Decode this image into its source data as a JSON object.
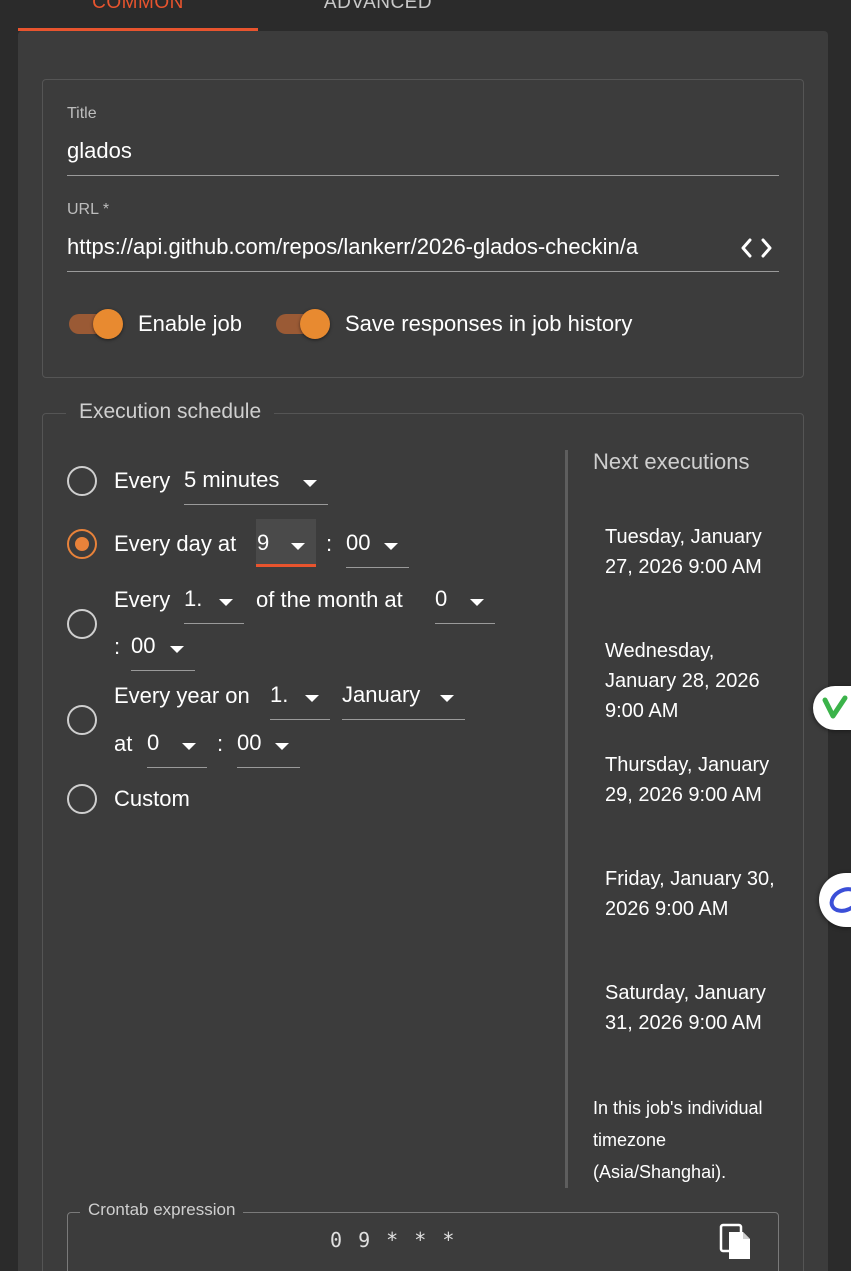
{
  "tabs": [
    {
      "label": "COMMON",
      "active": true
    },
    {
      "label": "ADVANCED",
      "active": false
    }
  ],
  "colors": {
    "accent": "#e8542e",
    "toggle_on": "#e88a30",
    "background": "#3c3c3c"
  },
  "form": {
    "title_label": "Title",
    "title_value": "glados",
    "url_label": "URL *",
    "url_value": "https://api.github.com/repos/lankerr/2026-glados-checkin/a",
    "url_icon": "code-icon",
    "toggles": [
      {
        "label": "Enable job",
        "on": true
      },
      {
        "label": "Save responses in job history",
        "on": true
      }
    ]
  },
  "schedule": {
    "legend": "Execution schedule",
    "option_minutes": {
      "prefix": "Every",
      "value": "5 minutes",
      "checked": false
    },
    "option_day": {
      "prefix": "Every day at",
      "hour": "9",
      "sep": ":",
      "minute": "00",
      "checked": true
    },
    "option_month": {
      "prefix": "Every",
      "day": "1.",
      "middle": "of the month at",
      "hour": "0",
      "sep": ":",
      "minute": "00",
      "checked": false
    },
    "option_year": {
      "prefix": "Every year on",
      "day": "1.",
      "month": "January",
      "at": "at",
      "hour": "0",
      "sep": ":",
      "minute": "00",
      "checked": false
    },
    "option_custom": {
      "label": "Custom",
      "checked": false
    }
  },
  "next": {
    "title": "Next executions",
    "items": [
      "Tuesday, January 27, 2026 9:00 AM",
      "Wednesday, January 28, 2026 9:00 AM",
      "Thursday, January 29, 2026 9:00 AM",
      "Friday, January 30, 2026 9:00 AM",
      "Saturday, January 31, 2026 9:00 AM"
    ],
    "timezone_note": "In this job's individual timezone (Asia/Shanghai)."
  },
  "crontab": {
    "label": "Crontab expression",
    "value": "0 9 * * *",
    "copy_icon": "copy-icon"
  }
}
